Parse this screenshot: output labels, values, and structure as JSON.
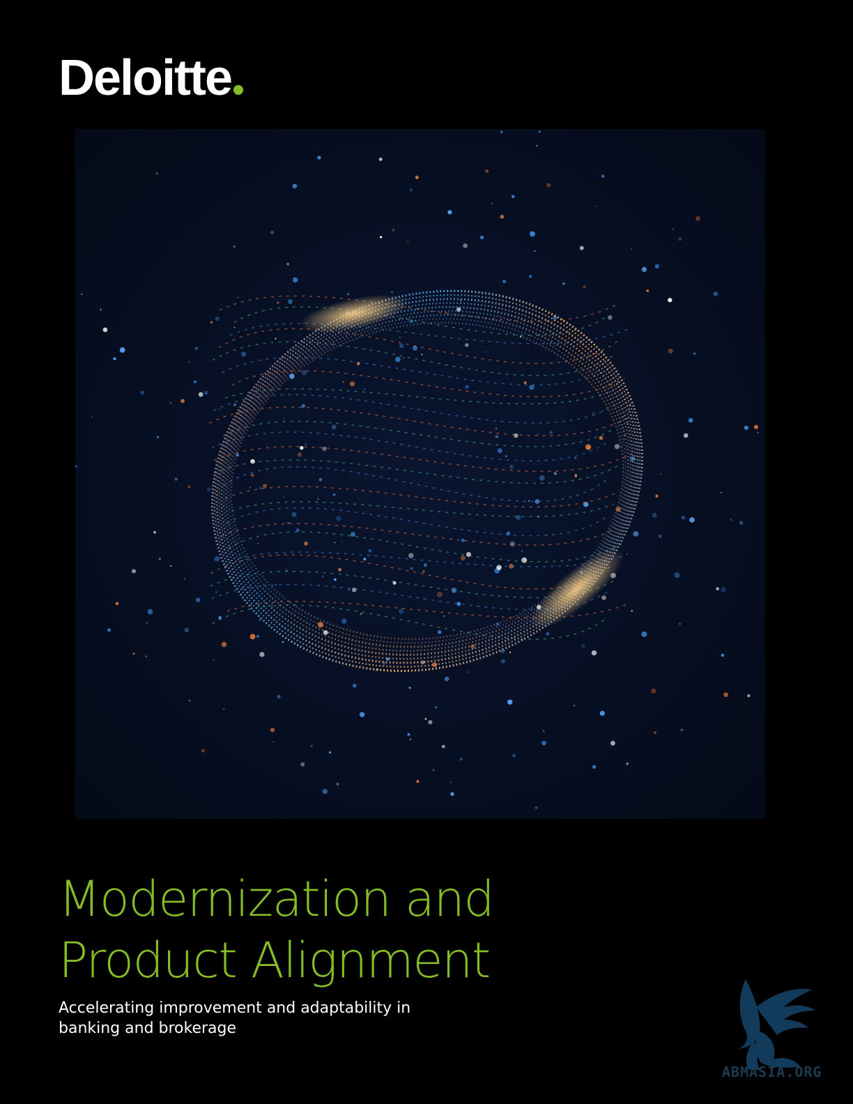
{
  "brand": {
    "logo_text": "Deloitte",
    "logo_dot_color": "#86bc25"
  },
  "cover_image": {
    "icon": "abstract-particle-ring-illustration"
  },
  "title": {
    "line1": "Modernization and",
    "line2": "Product Alignment",
    "color": "#86bc25"
  },
  "subtitle": {
    "line1": "Accelerating improvement and adaptability in",
    "line2": "banking and brokerage"
  },
  "watermark": {
    "text": "ABMASIA.ORG",
    "icon": "griffin-watermark-icon"
  }
}
